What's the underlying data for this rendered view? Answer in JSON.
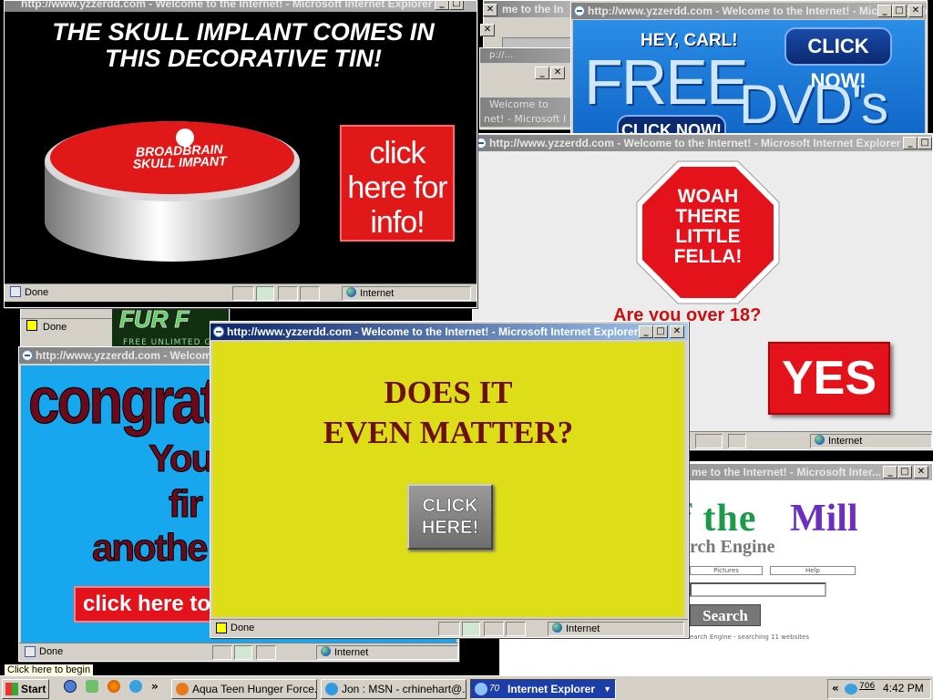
{
  "common": {
    "url_title": "http://www.yzzerdd.com - Welcome to the Internet! - Microsoft Internet Explorer",
    "status_done": "Done",
    "zone_internet": "Internet",
    "min_glyph": "_",
    "max_glyph": "□",
    "close_glyph": "✕"
  },
  "popups": {
    "skull": {
      "title": "http://www.yzzerdd.com - Welcome to the Internet! - Microsoft Internet Explorer",
      "headline": "THE SKULL IMPLANT COMES IN THIS DECORATIVE TIN!",
      "tin_label_1": "BROADBRAIN",
      "tin_label_2": "SKULL IMPANT",
      "cta": "click here for info!"
    },
    "dvd": {
      "greeting": "HEY, CARL!",
      "cta_top": "CLICK NOW!",
      "free": "FREE",
      "dvds": "DVD's",
      "cta_bottom": "CLICK NOW!"
    },
    "stop": {
      "sign": "WOAH THERE LITTLE FELLA!",
      "question": "Are you over 18?",
      "yes": "YES"
    },
    "congrats": {
      "line1": "congrat",
      "line2": "You",
      "line3": "fir",
      "line4": "anothe",
      "cta": "click here to g"
    },
    "matter": {
      "headline_1": "DOES IT",
      "headline_2": "EVEN MATTER?",
      "cta": "CLICK HERE!"
    },
    "search": {
      "title_fragment": "me to the Internet! - Microsoft Inter...",
      "logo_part1": "f the",
      "logo_part2": "Mill",
      "subtitle": "rch Engine",
      "tab_pictures": "Pictures",
      "tab_help": "Help",
      "search_button": "Search",
      "footer": "earch Engine - searching 11 websites"
    },
    "bg_fragments": {
      "frag_a": "me to the In",
      "frag_b": "Welcome to",
      "frag_c": "net! - Microsoft I",
      "frag_d": "p://...",
      "banner_text": "FUR F",
      "banner_small": "FREE UNLIMTED G"
    }
  },
  "tooltip": "Click here to begin",
  "taskbar": {
    "start": "Start",
    "quick_more": "»",
    "tasks": [
      {
        "label": "Aqua Teen Hunger Force..."
      },
      {
        "label": "Jon : MSN - crhinehart@..."
      },
      {
        "label": "Internet Explorer",
        "count": "70"
      }
    ],
    "tray_expand": "«",
    "tray_badge": "706",
    "clock": "4:42 PM"
  },
  "colors": {
    "title_active": "#0a246a",
    "title_inactive": "#808080",
    "yellow_bg": "#dede18",
    "sky_bg": "#1aa3e8",
    "red": "#e3121b"
  }
}
